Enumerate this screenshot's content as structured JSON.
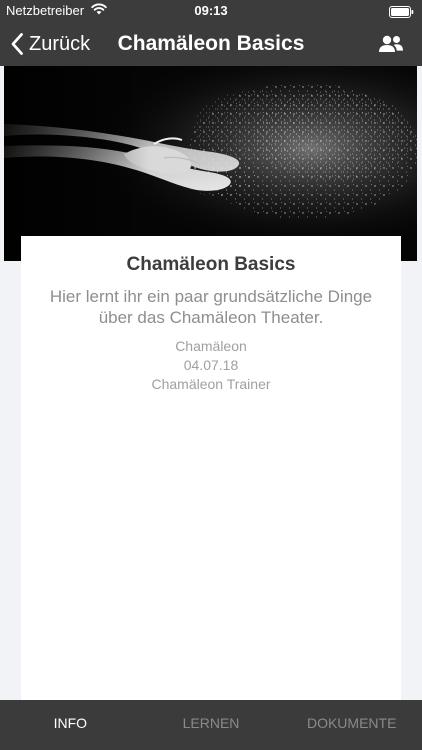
{
  "status_bar": {
    "carrier": "Netzbetreiber",
    "time": "09:13"
  },
  "nav": {
    "back_label": "Zurück",
    "title": "Chamäleon Basics",
    "people_icon": "people-icon"
  },
  "course": {
    "title": "Chamäleon Basics",
    "description": "Hier lernt ihr ein paar grundsätzliche Dinge über das Chamäleon Theater.",
    "organization": "Chamäleon",
    "date": "04.07.18",
    "trainer": "Chamäleon Trainer"
  },
  "tabs": [
    {
      "label": "INFO",
      "active": true
    },
    {
      "label": "LERNEN",
      "active": false
    },
    {
      "label": "DOKUMENTE",
      "active": false
    }
  ],
  "colors": {
    "nav_background": "#3c3c3c",
    "tab_background": "#3b3b3b",
    "page_background": "#f1f3f6",
    "title_text": "#3d3d3d",
    "muted_text": "#8e8e8e"
  }
}
